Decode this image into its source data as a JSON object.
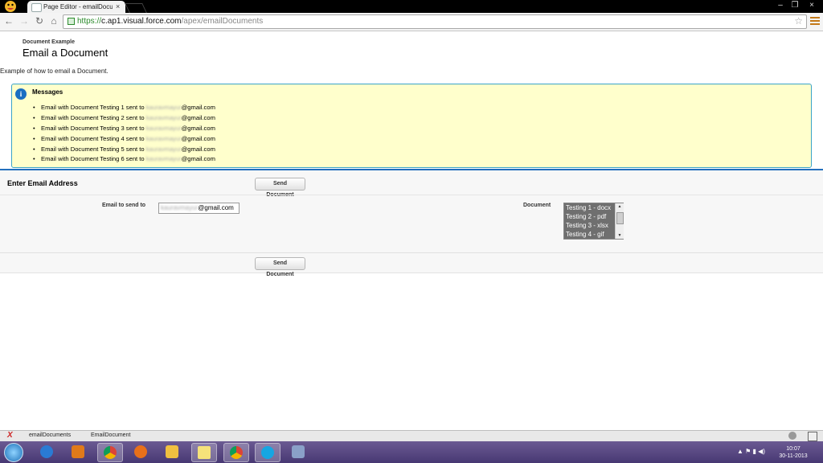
{
  "browser": {
    "tab_title": "Page Editor - emailDocum",
    "tab_close": "×",
    "url_protocol": "https://",
    "url_host": "c.ap1.visual.force.com",
    "url_path": "/apex/emailDocuments",
    "window_min": "–",
    "window_max": "❐",
    "window_close": "×"
  },
  "page": {
    "breadcrumb": "Document Example",
    "title": "Email a Document",
    "description": "Example of how to email a Document."
  },
  "messages": {
    "title": "Messages",
    "items": [
      {
        "prefix": "Email with Document Testing 1 sent to ",
        "blur": "kauravmayur",
        "suffix": "@gmail.com"
      },
      {
        "prefix": "Email with Document Testing 2 sent to ",
        "blur": "kauravmayur",
        "suffix": "@gmail.com"
      },
      {
        "prefix": "Email with Document Testing 3 sent to ",
        "blur": "kauravmayur",
        "suffix": "@gmail.com"
      },
      {
        "prefix": "Email with Document Testing 4 sent to ",
        "blur": "kauravmayur",
        "suffix": "@gmail.com"
      },
      {
        "prefix": "Email with Document Testing 5 sent to ",
        "blur": "kauravmayur",
        "suffix": "@gmail.com"
      },
      {
        "prefix": "Email with Document Testing 6 sent to ",
        "blur": "kauravmayur",
        "suffix": "@gmail.com"
      }
    ]
  },
  "form": {
    "section_title": "Enter Email Address",
    "send_button_top": "Send Document",
    "send_button_bottom": "Send Document",
    "email_label": "Email to send to",
    "email_value_blur": "kauravmayur",
    "email_value_suffix": "@gmail.com",
    "document_label": "Document",
    "document_options": [
      "Testing 1 - docx",
      "Testing 2 - pdf",
      "Testing 3 - xlsx",
      "Testing 4 - gif"
    ]
  },
  "devbar": {
    "item1": "emailDocuments",
    "item2": "EmailDocument"
  },
  "taskbar": {
    "time": "10:07",
    "date": "30-11-2013"
  },
  "colors": {
    "accent_blue": "#236fbd",
    "message_bg": "#ffffcc",
    "chrome_orange": "#c47a1a"
  }
}
